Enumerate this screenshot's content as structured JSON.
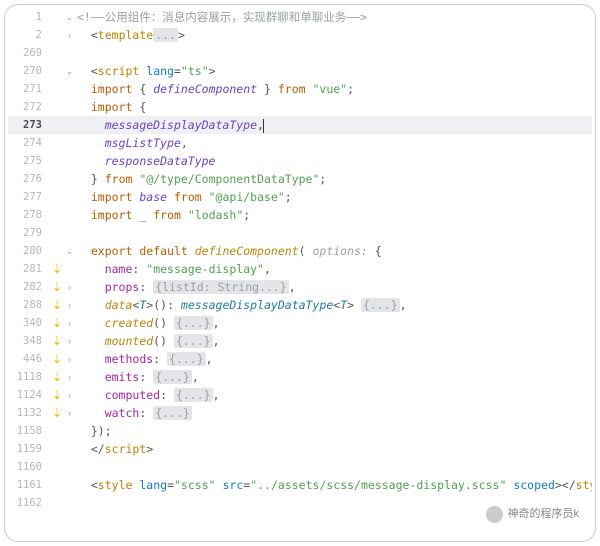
{
  "watermark": "神奇的程序员k",
  "lines": [
    {
      "n": 1,
      "fold": "v",
      "tokens": [
        [
          "cmt",
          "<!——公用组件：消息内容展示，实现群聊和单聊业务——>"
        ]
      ]
    },
    {
      "n": 2,
      "fold": ">",
      "indent": 1,
      "tokens": [
        [
          "punc",
          "<"
        ],
        [
          "tag",
          "template"
        ],
        [
          "fold-pill",
          "..."
        ],
        [
          "punc",
          ">"
        ]
      ]
    },
    {
      "n": 269,
      "tokens": []
    },
    {
      "n": 270,
      "fold": "v",
      "indent": 1,
      "tokens": [
        [
          "punc",
          "<"
        ],
        [
          "tag",
          "script"
        ],
        [
          "txt",
          " "
        ],
        [
          "attr",
          "lang"
        ],
        [
          "punc",
          "="
        ],
        [
          "str",
          "\"ts\""
        ],
        [
          "punc",
          ">"
        ]
      ]
    },
    {
      "n": 271,
      "indent": 1,
      "tokens": [
        [
          "kw",
          "import"
        ],
        [
          "txt",
          " "
        ],
        [
          "punc",
          "{ "
        ],
        [
          "id",
          "defineComponent"
        ],
        [
          "punc",
          " }"
        ],
        [
          "txt",
          " "
        ],
        [
          "kw",
          "from"
        ],
        [
          "txt",
          " "
        ],
        [
          "str",
          "\"vue\""
        ],
        [
          "punc",
          ";"
        ]
      ]
    },
    {
      "n": 272,
      "indent": 1,
      "tokens": [
        [
          "kw",
          "import"
        ],
        [
          "txt",
          " "
        ],
        [
          "punc",
          "{"
        ]
      ]
    },
    {
      "n": 273,
      "active": true,
      "indent": 2,
      "tokens": [
        [
          "id",
          "messageDisplayDataType"
        ],
        [
          "punc",
          ","
        ],
        [
          "caret",
          ""
        ]
      ]
    },
    {
      "n": 274,
      "indent": 2,
      "tokens": [
        [
          "id",
          "msgListType"
        ],
        [
          "punc",
          ","
        ]
      ]
    },
    {
      "n": 275,
      "indent": 2,
      "tokens": [
        [
          "id",
          "responseDataType"
        ]
      ]
    },
    {
      "n": 276,
      "indent": 1,
      "tokens": [
        [
          "punc",
          "} "
        ],
        [
          "kw",
          "from"
        ],
        [
          "txt",
          " "
        ],
        [
          "str",
          "\"@/type/ComponentDataType\""
        ],
        [
          "punc",
          ";"
        ]
      ]
    },
    {
      "n": 277,
      "indent": 1,
      "tokens": [
        [
          "kw",
          "import"
        ],
        [
          "txt",
          " "
        ],
        [
          "id",
          "base"
        ],
        [
          "txt",
          " "
        ],
        [
          "kw",
          "from"
        ],
        [
          "txt",
          " "
        ],
        [
          "str",
          "\"@api/base\""
        ],
        [
          "punc",
          ";"
        ]
      ]
    },
    {
      "n": 278,
      "indent": 1,
      "tokens": [
        [
          "kw",
          "import"
        ],
        [
          "txt",
          " "
        ],
        [
          "id",
          "_"
        ],
        [
          "txt",
          " "
        ],
        [
          "kw",
          "from"
        ],
        [
          "txt",
          " "
        ],
        [
          "str",
          "\"lodash\""
        ],
        [
          "punc",
          ";"
        ]
      ]
    },
    {
      "n": 279,
      "tokens": []
    },
    {
      "n": 280,
      "fold": "v",
      "indent": 1,
      "tokens": [
        [
          "kw",
          "export"
        ],
        [
          "txt",
          " "
        ],
        [
          "kw",
          "default"
        ],
        [
          "txt",
          " "
        ],
        [
          "fn",
          "defineComponent"
        ],
        [
          "punc",
          "( "
        ],
        [
          "param",
          "options: "
        ],
        [
          "punc",
          "{"
        ]
      ]
    },
    {
      "n": 281,
      "icon": "impl",
      "indent": 2,
      "tokens": [
        [
          "prop",
          "name"
        ],
        [
          "punc",
          ": "
        ],
        [
          "str",
          "\"message-display\""
        ],
        [
          "punc",
          ","
        ]
      ]
    },
    {
      "n": 282,
      "icon": "impl",
      "fold": ">",
      "indent": 2,
      "tokens": [
        [
          "prop",
          "props"
        ],
        [
          "punc",
          ": "
        ],
        [
          "fold-pill",
          "{listId: String...}"
        ],
        [
          "punc",
          ","
        ]
      ]
    },
    {
      "n": 288,
      "icon": "impl",
      "fold": ">",
      "indent": 2,
      "tokens": [
        [
          "fn",
          "data"
        ],
        [
          "punc",
          "<"
        ],
        [
          "type",
          "T"
        ],
        [
          "punc",
          ">"
        ],
        [
          "punc",
          "(): "
        ],
        [
          "type",
          "messageDisplayDataType"
        ],
        [
          "punc",
          "<"
        ],
        [
          "type",
          "T"
        ],
        [
          "punc",
          "> "
        ],
        [
          "fold-pill",
          "{...}"
        ],
        [
          "punc",
          ","
        ]
      ]
    },
    {
      "n": 340,
      "icon": "impl",
      "fold": ">",
      "indent": 2,
      "tokens": [
        [
          "fn",
          "created"
        ],
        [
          "punc",
          "() "
        ],
        [
          "fold-pill",
          "{...}"
        ],
        [
          "punc",
          ","
        ]
      ]
    },
    {
      "n": 348,
      "icon": "impl",
      "fold": ">",
      "indent": 2,
      "tokens": [
        [
          "fn",
          "mounted"
        ],
        [
          "punc",
          "() "
        ],
        [
          "fold-pill",
          "{...}"
        ],
        [
          "punc",
          ","
        ]
      ]
    },
    {
      "n": 446,
      "icon": "impl",
      "fold": ">",
      "indent": 2,
      "tokens": [
        [
          "prop",
          "methods"
        ],
        [
          "punc",
          ": "
        ],
        [
          "fold-pill",
          "{...}"
        ],
        [
          "punc",
          ","
        ]
      ]
    },
    {
      "n": 1118,
      "icon": "impl",
      "fold": ">",
      "indent": 2,
      "tokens": [
        [
          "prop",
          "emits"
        ],
        [
          "punc",
          ": "
        ],
        [
          "fold-pill",
          "{...}"
        ],
        [
          "punc",
          ","
        ]
      ]
    },
    {
      "n": 1124,
      "icon": "impl",
      "fold": ">",
      "indent": 2,
      "tokens": [
        [
          "prop",
          "computed"
        ],
        [
          "punc",
          ": "
        ],
        [
          "fold-pill",
          "{...}"
        ],
        [
          "punc",
          ","
        ]
      ]
    },
    {
      "n": 1132,
      "icon": "impl",
      "fold": ">",
      "indent": 2,
      "tokens": [
        [
          "prop",
          "watch"
        ],
        [
          "punc",
          ": "
        ],
        [
          "fold-pill",
          "{...}"
        ]
      ]
    },
    {
      "n": 1158,
      "fold": "-",
      "indent": 1,
      "tokens": [
        [
          "punc",
          "});"
        ]
      ]
    },
    {
      "n": 1159,
      "fold": "-",
      "indent": 1,
      "tokens": [
        [
          "punc",
          "</"
        ],
        [
          "tag",
          "script"
        ],
        [
          "punc",
          ">"
        ]
      ]
    },
    {
      "n": 1160,
      "tokens": []
    },
    {
      "n": 1161,
      "indent": 1,
      "tokens": [
        [
          "punc",
          "<"
        ],
        [
          "tag",
          "style"
        ],
        [
          "txt",
          " "
        ],
        [
          "attr",
          "lang"
        ],
        [
          "punc",
          "="
        ],
        [
          "str",
          "\"scss\""
        ],
        [
          "txt",
          " "
        ],
        [
          "attr",
          "src"
        ],
        [
          "punc",
          "="
        ],
        [
          "str",
          "\"../assets/scss/message-display.scss\""
        ],
        [
          "txt",
          " "
        ],
        [
          "attr",
          "scoped"
        ],
        [
          "punc",
          "></"
        ],
        [
          "tag",
          "style"
        ],
        [
          "punc",
          ">"
        ]
      ]
    },
    {
      "n": 1162,
      "tokens": []
    }
  ]
}
